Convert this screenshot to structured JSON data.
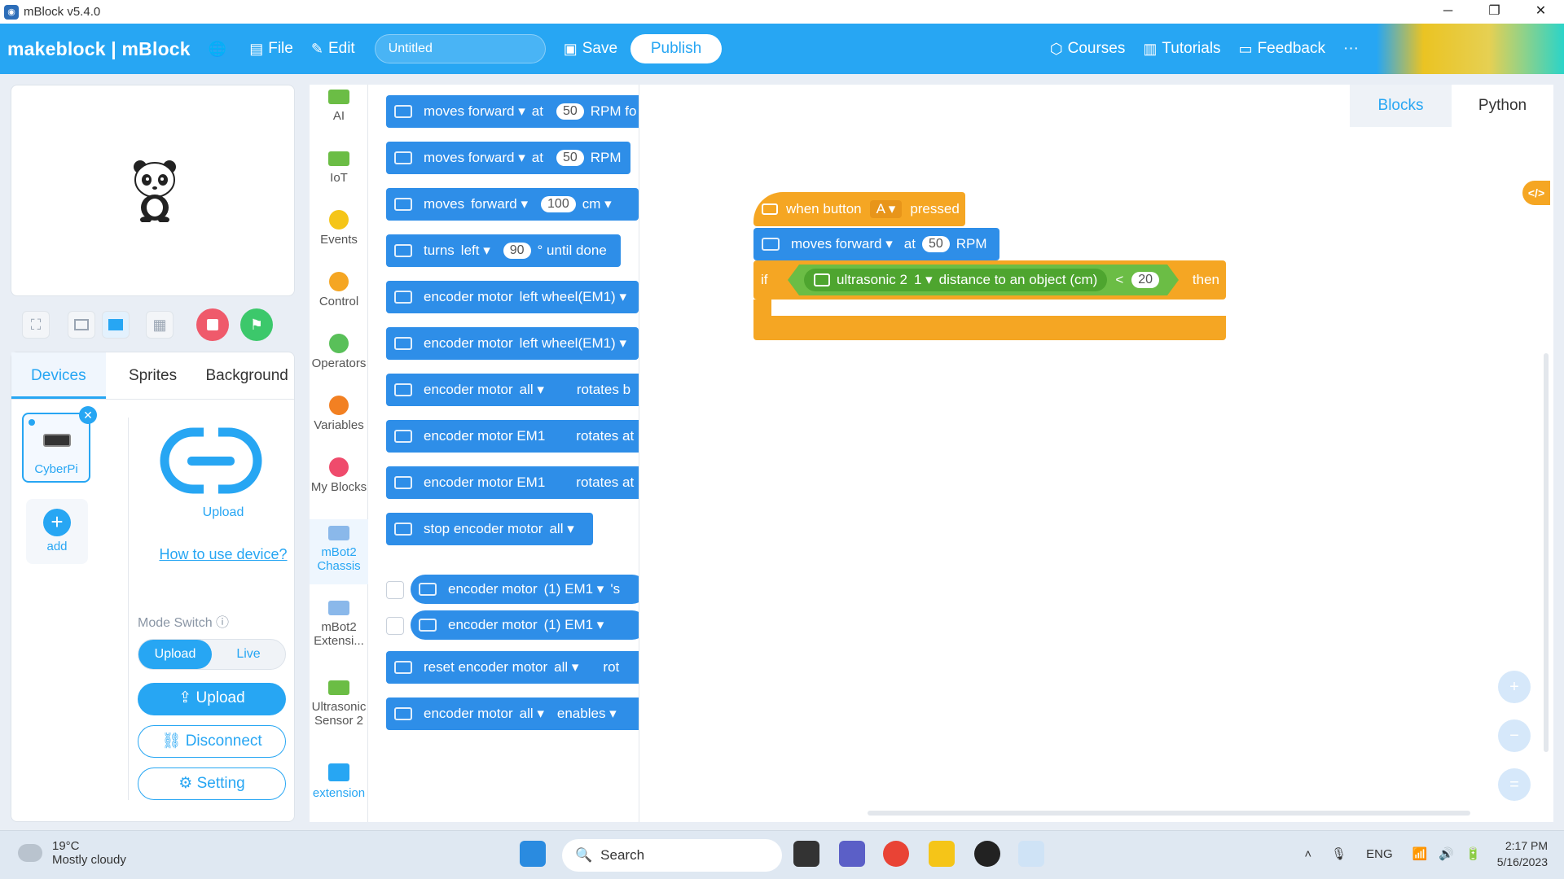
{
  "titlebar": {
    "title": "mBlock v5.4.0",
    "minimize": "─",
    "restore": "❐",
    "close": "✕"
  },
  "menubar": {
    "logo": "makeblock | mBlock",
    "file": "File",
    "edit": "Edit",
    "project_title": "Untitled",
    "save": "Save",
    "publish": "Publish",
    "courses": "Courses",
    "tutorials": "Tutorials",
    "feedback": "Feedback",
    "more": "···"
  },
  "devices": {
    "tabs": [
      "Devices",
      "Sprites",
      "Background"
    ],
    "device_name": "CyberPi",
    "add_label": "add",
    "upload_label": "Upload",
    "how_to": "How to use device?",
    "mode_switch": "Mode Switch",
    "mode_upload": "Upload",
    "mode_live": "Live",
    "btn_upload": "Upload",
    "btn_disconnect": "Disconnect",
    "btn_setting": "Setting"
  },
  "categories": [
    {
      "label": "AI",
      "color": "#6bbd45"
    },
    {
      "label": "IoT",
      "color": "#6bbd45"
    },
    {
      "label": "Events",
      "color": "#f5c518"
    },
    {
      "label": "Control",
      "color": "#f5a623"
    },
    {
      "label": "Operators",
      "color": "#59c059"
    },
    {
      "label": "Variables",
      "color": "#f28022"
    },
    {
      "label": "My Blocks",
      "color": "#ef4b6c"
    },
    {
      "label": "mBot2 Chassis",
      "color": "#2e8ee8"
    },
    {
      "label": "mBot2 Extensi...",
      "color": "#2e8ee8"
    },
    {
      "label": "Ultrasonic Sensor 2",
      "color": "#6bbd45"
    },
    {
      "label": "extension",
      "color": "#27a6f3"
    }
  ],
  "palette": {
    "b1": {
      "a": "moves forward ▾",
      "b": "at",
      "c": "50",
      "d": "RPM fo"
    },
    "b2": {
      "a": "moves forward ▾",
      "b": "at",
      "c": "50",
      "d": "RPM"
    },
    "b3": {
      "a": "moves",
      "b": "forward ▾",
      "c": "100",
      "d": "cm ▾"
    },
    "b4": {
      "a": "turns",
      "b": "left ▾",
      "c": "90",
      "d": "° until done"
    },
    "b5": {
      "a": "encoder motor",
      "b": "left wheel(EM1) ▾"
    },
    "b6": {
      "a": "encoder motor",
      "b": "left wheel(EM1) ▾"
    },
    "b7": {
      "a": "encoder motor",
      "b": "all ▾",
      "c": "rotates b"
    },
    "b8": {
      "a": "encoder motor EM1",
      "b": "rotates at"
    },
    "b9": {
      "a": "encoder motor EM1",
      "b": "rotates at"
    },
    "b10": {
      "a": "stop encoder motor",
      "b": "all ▾"
    },
    "r1": {
      "a": "encoder motor",
      "b": "(1) EM1 ▾",
      "c": "'s"
    },
    "r2": {
      "a": "encoder motor",
      "b": "(1) EM1 ▾"
    },
    "b11": {
      "a": "reset encoder motor",
      "b": "all ▾",
      "c": "rot"
    },
    "b12": {
      "a": "encoder motor",
      "b": "all ▾",
      "c": "enables ▾"
    }
  },
  "workspace": {
    "tabs": [
      "Blocks",
      "Python"
    ],
    "code_toggle": "</>",
    "hat": {
      "a": "when button",
      "b": "A ▾",
      "c": "pressed"
    },
    "move": {
      "a": "moves forward ▾",
      "b": "at",
      "c": "50",
      "d": "RPM"
    },
    "if": {
      "if": "if",
      "sensor": "ultrasonic 2",
      "port": "1 ▾",
      "text": "distance to an object (cm)",
      "op": "<",
      "value": "20",
      "then": "then"
    },
    "zoom_in": "+",
    "zoom_out": "−",
    "zoom_reset": "="
  },
  "taskbar": {
    "temp": "19°C",
    "weather": "Mostly cloudy",
    "search": "Search",
    "lang": "ENG",
    "time": "2:17 PM",
    "date": "5/16/2023"
  }
}
